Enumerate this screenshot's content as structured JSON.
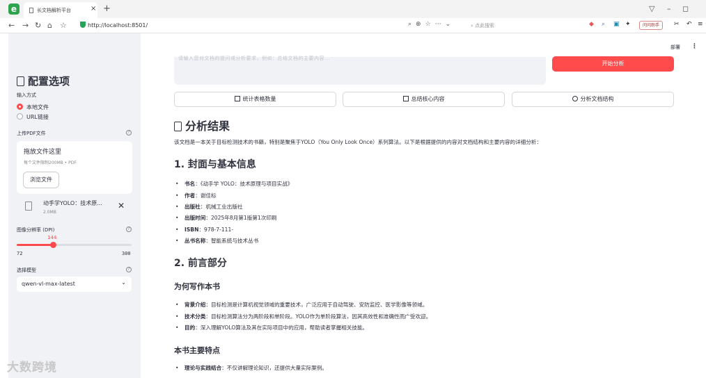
{
  "browser": {
    "app_icon": "e",
    "tab_title": "长文档解析平台",
    "url": "http://localhost:8501/",
    "search_placeholder": "点此搜索",
    "ext_badge": "问问助手"
  },
  "sidebar": {
    "title": "配置选项",
    "input_method": {
      "label": "输入方式",
      "options": [
        "本地文件",
        "URL链接"
      ],
      "selected": 0
    },
    "upload": {
      "label": "上传PDF文件",
      "drop_text": "拖放文件这里",
      "limit": "每个文件限制200MB • PDF",
      "browse_label": "浏览文件",
      "file_name": "动手学YOLO：技术原...",
      "file_size": "2.0MB"
    },
    "dpi": {
      "label": "图像分辨率 (DPI)",
      "value": "144",
      "min": "72",
      "max": "300"
    },
    "model": {
      "label": "选择模型",
      "selected": "qwen-vl-max-latest"
    }
  },
  "main": {
    "deploy": "部署",
    "textarea_placeholder": "请输入您对文档的提问或分析要求，例如：总结文档的主要内容...",
    "start_button": "开始分析",
    "actions": [
      "统计表格数量",
      "总结核心内容",
      "分析文档结构"
    ],
    "result_title": "分析结果",
    "intro": "该文档是一本关于目标检测技术的书籍，特别是聚焦于YOLO（You Only Look Once）系列算法。以下是根据提供的内容对文档结构和主要内容的详细分析：",
    "section1": {
      "title": "1. 封面与基本信息",
      "items": [
        {
          "k": "书名",
          "v": "：《动手学 YOLO：技术原理与项目实战》"
        },
        {
          "k": "作者",
          "v": "：谢佳标"
        },
        {
          "k": "出版社",
          "v": "：机械工业出版社"
        },
        {
          "k": "出版时间",
          "v": "：2025年8月第1版第1次印刷"
        },
        {
          "k": "ISBN",
          "v": "：978-7-111-"
        },
        {
          "k": "丛书名称",
          "v": "：智能系统与技术丛书"
        }
      ]
    },
    "section2": {
      "title": "2. 前言部分",
      "sub1": "为何写作本书",
      "sub1_items": [
        {
          "k": "背景介绍",
          "v": "：目标检测是计算机视觉领域的重要技术，广泛应用于自动驾驶、安防监控、医学影像等领域。"
        },
        {
          "k": "技术分类",
          "v": "：目标检测算法分为两阶段和单阶段。YOLO作为单阶段算法，因其高效性和准确性而广受欢迎。"
        },
        {
          "k": "目的",
          "v": "：深入理解YOLO算法及其在实际项目中的应用，帮助读者掌握相关技能。"
        }
      ],
      "sub2": "本书主要特点",
      "sub2_items": [
        {
          "k": "理论与实践结合",
          "v": "：不仅讲解理论知识，还提供大量实际案例。"
        }
      ]
    }
  },
  "watermark": "大数跨境",
  "colors": {
    "accent": "#ff4b4b",
    "sidebar_bg": "#f0f2f6",
    "text": "#31333f"
  }
}
